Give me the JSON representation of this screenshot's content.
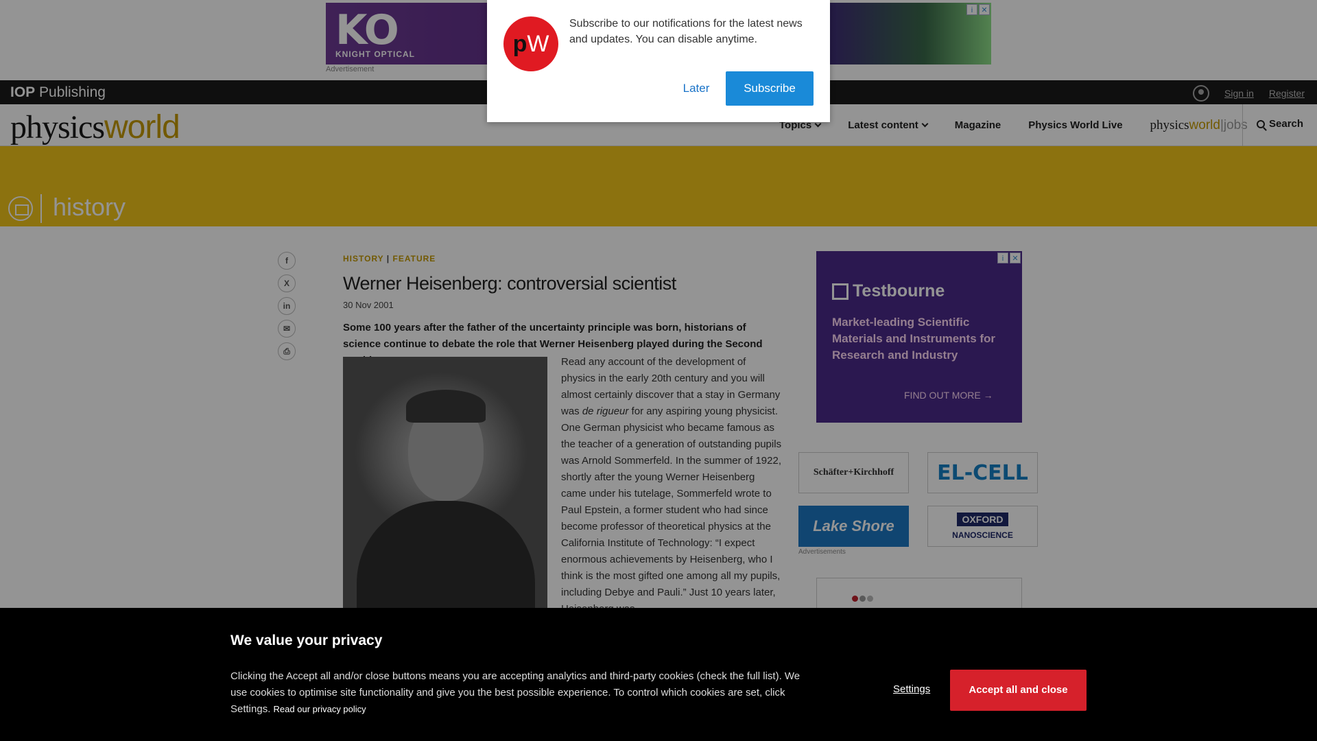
{
  "top_ad": {
    "brand": "KO",
    "brand_sub": "KNIGHT OPTICAL",
    "label": "Advertisement"
  },
  "iop": {
    "logo_bold": "IOP",
    "logo_rest": " Publishing",
    "sign_in": "Sign in",
    "register": "Register"
  },
  "nav": {
    "logo_a": "physics",
    "logo_b": "world",
    "items": [
      "Topics",
      "Latest content",
      "Magazine",
      "Physics World Live"
    ],
    "jobs_a": "physics",
    "jobs_b": "world",
    "jobs_c": "|jobs",
    "search": "Search"
  },
  "section": {
    "title": "history"
  },
  "article": {
    "crumb_1": "HISTORY",
    "crumb_sep": " | ",
    "crumb_2": "FEATURE",
    "title": "Werner Heisenberg: controversial scientist",
    "date": "30 Nov 2001",
    "standfirst": "Some 100 years after the father of the uncertainty principle was born, historians of science continue to debate the role that Werner Heisenberg played during the Second World War",
    "body_1": "Read any account of the development of physics in the early 20th century and you will almost certainly discover that a stay in Germany was ",
    "body_italic": "de rigueur",
    "body_2": " for any aspiring young physicist. One German physicist who became famous as the teacher of a generation of outstanding pupils was Arnold Sommerfeld. In the summer of 1922, shortly after the young Werner Heisenberg came under his tutelage, Sommerfeld wrote to Paul Epstein, a former student who had since become professor of theoretical physics at the California Institute of Technology: “I expect enormous achievements by Heisenberg, who I think is the most gifted one among all my pupils, including Debye and Pauli.” Just 10 years later, Heisenberg was"
  },
  "share": {
    "facebook": "f",
    "x": "X",
    "linkedin": "in",
    "email": "✉",
    "print": "⎙"
  },
  "sidebar": {
    "tb_brand": "Testbourne",
    "tb_text": "Market-leading Scientific Materials and Instruments for Research and Industry",
    "tb_cta": "FIND OUT MORE →",
    "ad1": "Schäfter+Kirchhoff",
    "ad2": "EL-CELL",
    "ad3": "Lake Shore",
    "ad4_top": "OXFORD",
    "ad4_bottom": "NANOSCIENCE",
    "ads_label": "Advertisements"
  },
  "notification": {
    "logo_p": "p",
    "logo_w": "W",
    "text": "Subscribe to our notifications for the latest news and updates. You can disable anytime.",
    "later": "Later",
    "subscribe": "Subscribe"
  },
  "cookie": {
    "title": "We value your privacy",
    "text": "Clicking the Accept all and/or close buttons means you are accepting analytics and third-party cookies (check the full list). We use cookies to optimise site functionality and give you the best possible experience. To control which cookies are set, click Settings. ",
    "privacy_link": "Read our privacy policy",
    "settings": "Settings",
    "accept": "Accept all and close"
  }
}
